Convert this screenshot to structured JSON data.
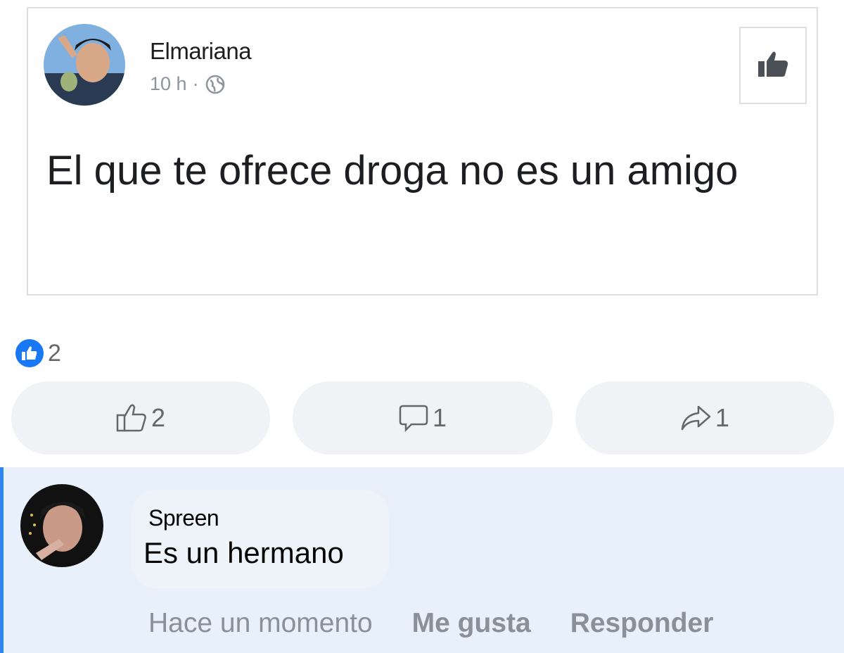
{
  "post": {
    "author": "Elmariana",
    "time": "10 h",
    "separator": "·",
    "text": "El que te ofrece droga no es un amigo"
  },
  "reactions": {
    "count": "2"
  },
  "actions": {
    "like_count": "2",
    "comment_count": "1",
    "share_count": "1"
  },
  "comment": {
    "author": "Spreen",
    "text": "Es un hermano",
    "time": "Hace un momento",
    "like_label": "Me gusta",
    "reply_label": "Responder"
  },
  "colors": {
    "accent": "#1877f2",
    "comment_bg": "#e7f0fb",
    "highlight_bar": "#2d86f3"
  },
  "icons": [
    "globe-icon",
    "thumbs-up-icon",
    "comment-icon",
    "share-icon"
  ]
}
